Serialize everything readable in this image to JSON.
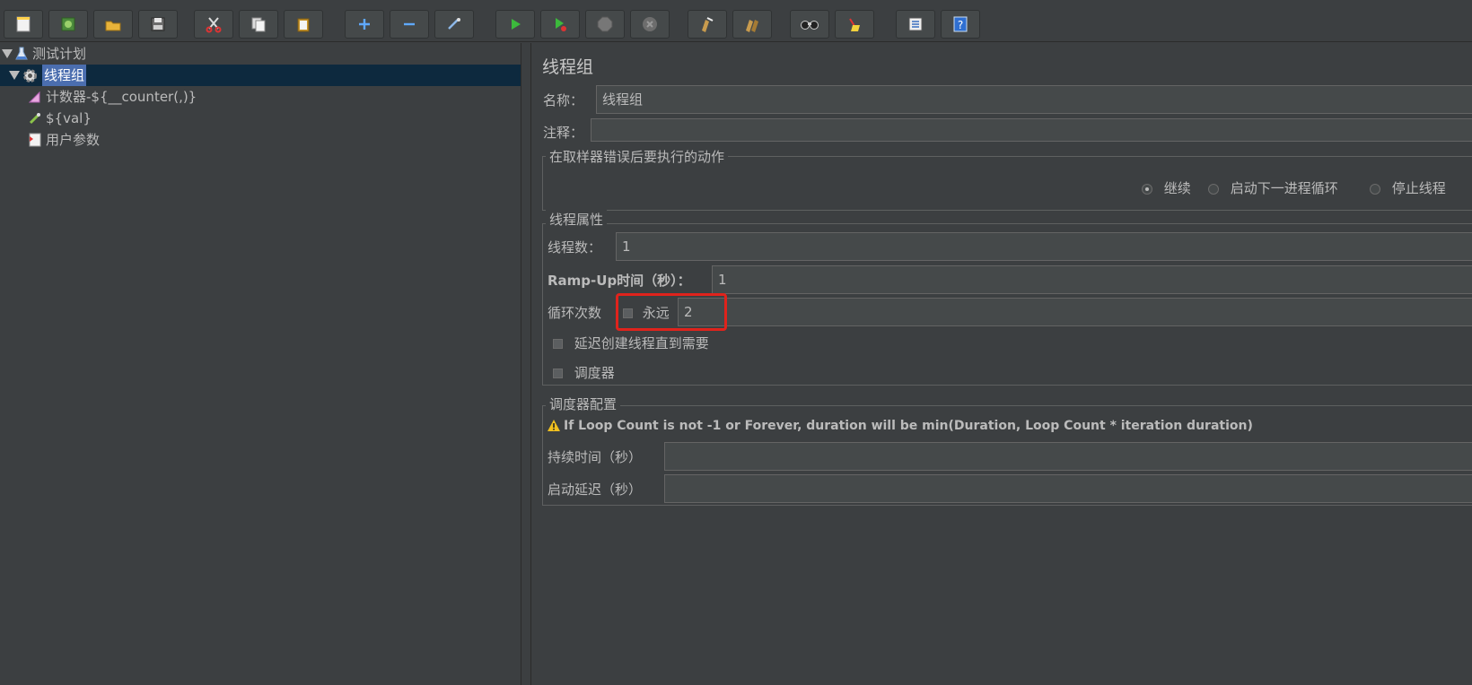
{
  "toolbar": {
    "buttons": [
      "new-icon",
      "templates-icon",
      "open-icon",
      "save-icon",
      "cut-icon",
      "copy-icon",
      "paste-icon",
      "expand-icon",
      "collapse-icon",
      "toggle-icon",
      "start-icon",
      "start-no-pause-icon",
      "stop-icon",
      "shutdown-icon",
      "clear-icon",
      "clear-all-icon",
      "search-icon",
      "reset-search-icon",
      "function-helper-icon",
      "help-icon"
    ]
  },
  "tree": {
    "plan": "测试计划",
    "thread_group": "线程组",
    "counter": "计数器-${__counter(,)}",
    "val": "${val}",
    "user_params": "用户参数"
  },
  "panel": {
    "title": "线程组",
    "name_label": "名称：",
    "name_value": "线程组",
    "comment_label": "注释：",
    "comment_value": "",
    "error_group": "在取样器错误后要执行的动作",
    "error_options": [
      "继续",
      "启动下一进程循环",
      "停止线程"
    ],
    "thread_props": "线程属性",
    "threads_label": "线程数：",
    "threads_value": "1",
    "rampup_label": "Ramp-Up时间（秒）：",
    "rampup_value": "1",
    "loop_label": "循环次数",
    "forever_label": "永远",
    "loop_value": "2",
    "delay_label": "延迟创建线程直到需要",
    "scheduler_label": "调度器",
    "scheduler_group": "调度器配置",
    "warning": "If Loop Count is not -1 or Forever, duration will be min(Duration, Loop Count * iteration duration)",
    "duration_label": "持续时间（秒）",
    "startup_delay_label": "启动延迟（秒）"
  },
  "colors": {
    "background": "#3c3f41",
    "selection": "#4b6eaf",
    "highlight": "#e0231c"
  }
}
